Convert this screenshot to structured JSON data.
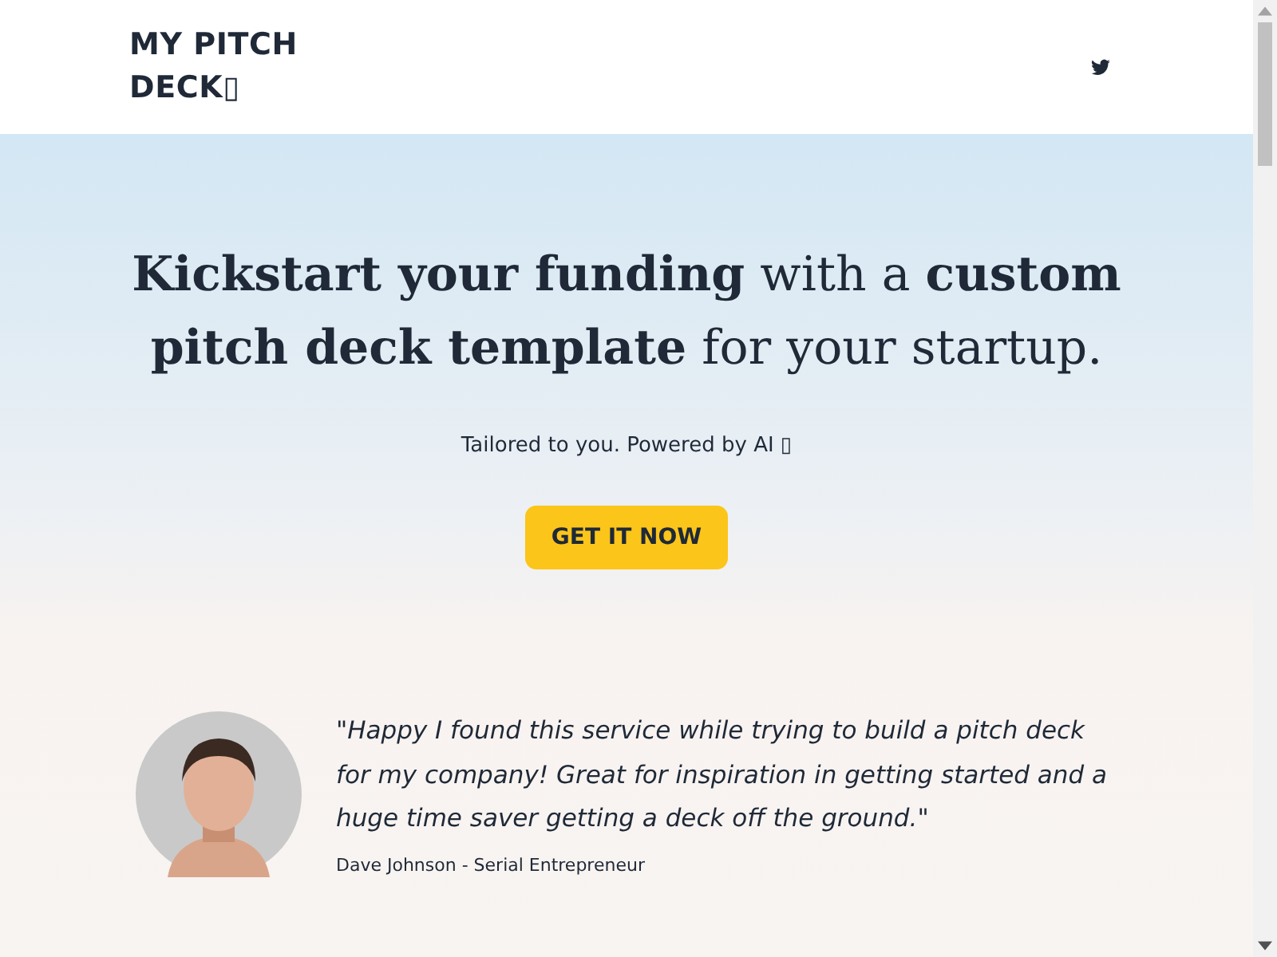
{
  "header": {
    "logo": "MY PITCH DECK▯"
  },
  "hero": {
    "headline": "**Kickstart your funding** with a **custom pitch deck template** for your startup.",
    "tagline": "Tailored to you. Powered by AI ▯",
    "cta": "GET IT NOW"
  },
  "testimonial": {
    "quote": "\"Happy I found this service while trying to build a pitch deck for my company! Great for inspiration in getting started and a huge time saver getting a deck off the ground.\"",
    "author": "Dave Johnson - Serial Entrepreneur"
  }
}
